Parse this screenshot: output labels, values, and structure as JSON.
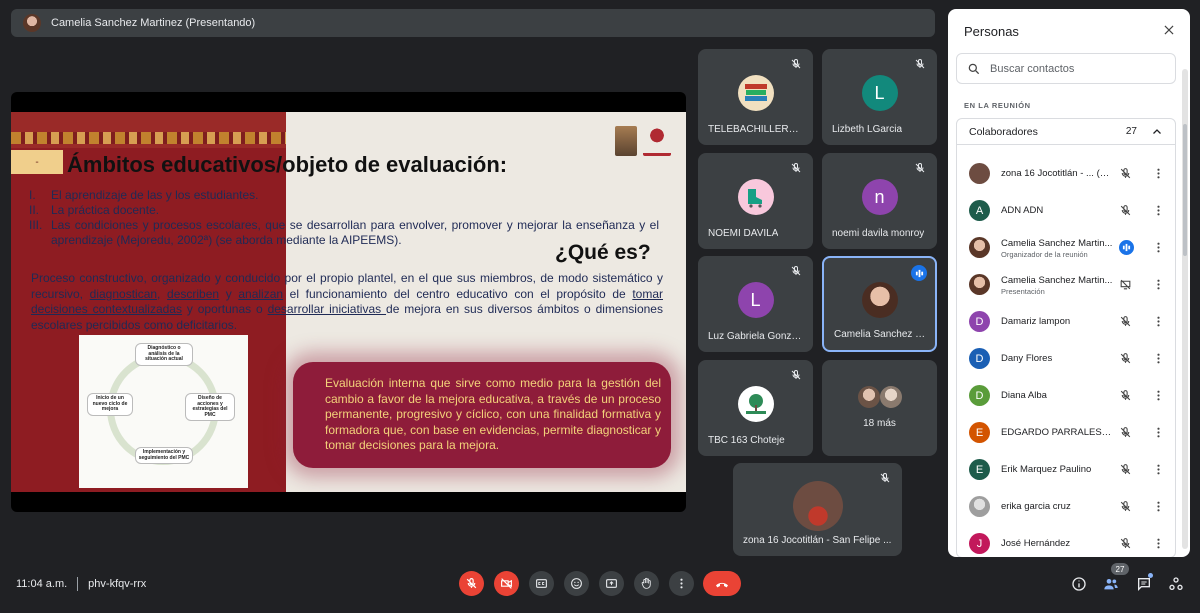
{
  "presenter_bar": {
    "text": "Camelia Sanchez Martinez (Presentando)"
  },
  "slide": {
    "tab_text": "-",
    "title": "Ámbitos educativos/objeto de evaluación:",
    "list": [
      {
        "num": "I.",
        "text": "El aprendizaje de las y los estudiantes."
      },
      {
        "num": "II.",
        "text": "La práctica docente."
      },
      {
        "num": "III.",
        "text": "Las condiciones y procesos escolares, que se desarrollan para envolver, promover y mejorar la enseñanza y el aprendizaje (Mejoredu, 2002ª) (se aborda mediante la AIPEEMS)."
      }
    ],
    "que_es": "¿Qué es?",
    "paragraph": {
      "p1": "Proceso constructivo, organizado y conducido por el propio plantel, en el que sus miembros, de modo sistemático y recursivo, ",
      "u1": "diagnostican",
      "p2": ", ",
      "u2": "describen",
      "p3": " y ",
      "u3": "analizan",
      "p4": " el funcionamiento del centro educativo con el propósito de ",
      "u4": "tomar decisiones contextualizadas",
      "p5": " y oportunas o ",
      "u5": "desarrollar iniciativas ",
      "p6": "de mejora en sus diversos ámbitos o dimensiones escolares percibidos como deficitarios."
    },
    "diagram": {
      "top": "Diagnóstico o análisis de la situación actual",
      "right": "Diseño de acciones y estrategias del PMC",
      "bottom": "Implementación y seguimiento del PMC",
      "left": "Inicio de un nuevo ciclo de mejora"
    },
    "highlight": "Evaluación interna que sirve como medio para la gestión del cambio a favor de la mejora educativa, a través de un proceso permanente, progresivo y cíclico, con una finalidad formativa y formadora que, con base en evidencias, permite diagnosticar y tomar decisiones para la mejora."
  },
  "tiles": [
    {
      "name": "TELEBACHILLERAT...",
      "avatar": "books-icon"
    },
    {
      "name": "Lizbeth LGarcia",
      "initial": "L",
      "color": "#12897c"
    },
    {
      "name": "NOEMI DAVILA",
      "avatar": "skate-icon"
    },
    {
      "name": "noemi davila monroy",
      "initial": "n",
      "color": "#8e44ad"
    },
    {
      "name": "Luz Gabriela Gonza...",
      "initial": "L",
      "color": "#8e44ad"
    },
    {
      "name": "Camelia Sanchez M...",
      "avatar": "photo"
    },
    {
      "name": "TBC 163 Choteje",
      "avatar": "tree-logo"
    },
    {
      "name": "18 más"
    },
    {
      "name": "zona 16 Jocotitlán - San Felipe ...",
      "avatar": "photo"
    }
  ],
  "panel": {
    "title": "Personas",
    "search_placeholder": "Buscar contactos",
    "section_label": "EN LA REUNIÓN",
    "group_label": "Colaboradores",
    "group_count": "27",
    "people": [
      {
        "name": "zona 16 Jocotitlán - ... (Tú)",
        "sub": "",
        "initial": "",
        "color": "#6d4c41"
      },
      {
        "name": "ADN ADN",
        "sub": "",
        "initial": "A",
        "color": "#1e5c4b"
      },
      {
        "name": "Camelia Sanchez Martin...",
        "sub": "Organizador de la reunión",
        "initial": "",
        "color": "#b0765f"
      },
      {
        "name": "Camelia Sanchez Martin...",
        "sub": "Presentación",
        "initial": "",
        "color": "#b0765f"
      },
      {
        "name": "Damariz lampon",
        "sub": "",
        "initial": "D",
        "color": "#8e44ad"
      },
      {
        "name": "Dany Flores",
        "sub": "",
        "initial": "D",
        "color": "#1a5fb4"
      },
      {
        "name": "Diana Alba",
        "sub": "",
        "initial": "D",
        "color": "#5a9c3a"
      },
      {
        "name": "EDGARDO PARRALES C...",
        "sub": "",
        "initial": "E",
        "color": "#d35400"
      },
      {
        "name": "Erik Marquez Paulino",
        "sub": "",
        "initial": "E",
        "color": "#1e5c4b"
      },
      {
        "name": "erika garcia cruz",
        "sub": "",
        "initial": "",
        "color": "#9e9e9e"
      },
      {
        "name": "José Hernández",
        "sub": "",
        "initial": "J",
        "color": "#c2185b"
      }
    ]
  },
  "bottom": {
    "time": "11:04 a.m.",
    "meeting_code": "phv-kfqv-rrx",
    "people_badge": "27"
  }
}
